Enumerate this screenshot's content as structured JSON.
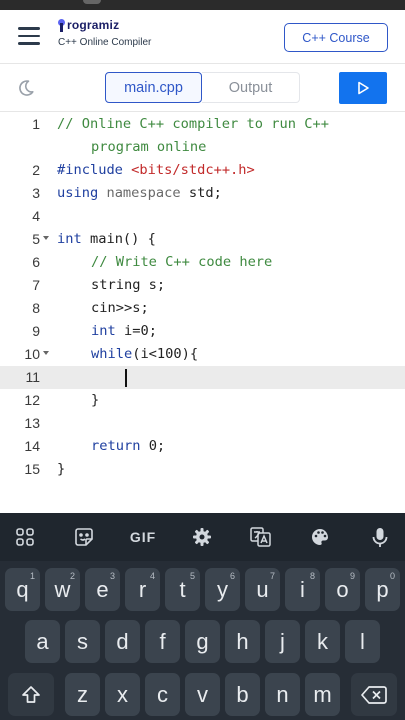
{
  "header": {
    "brand": "rogramiz",
    "subtitle": "C++ Online Compiler",
    "course_button": "C++ Course"
  },
  "toolbar": {
    "tab_main": "main.cpp",
    "tab_output": "Output"
  },
  "editor": {
    "lines": [
      {
        "n": "1",
        "text": "// Online C++ compiler to run C++"
      },
      {
        "n": "",
        "text": "program online"
      },
      {
        "n": "2",
        "pre": "#include ",
        "str": "<bits/stdc++.h>"
      },
      {
        "n": "3",
        "kw": "using",
        "mid": " ",
        "kw2": "namespace",
        "rest": " std;"
      },
      {
        "n": "4"
      },
      {
        "n": "5",
        "kw": "int",
        "rest": " main() {"
      },
      {
        "n": "6",
        "text": "// Write C++ code here"
      },
      {
        "n": "7",
        "rest": "string s;"
      },
      {
        "n": "8",
        "rest": "cin>>s;"
      },
      {
        "n": "9",
        "kw": "int",
        "rest": " i=0;"
      },
      {
        "n": "10",
        "kw": "while",
        "rest": "(i<100){"
      },
      {
        "n": "11"
      },
      {
        "n": "12",
        "rest": "}"
      },
      {
        "n": "13"
      },
      {
        "n": "14",
        "kw": "return",
        "rest": " 0;"
      },
      {
        "n": "15",
        "rest": "}"
      }
    ]
  },
  "keyboard": {
    "gif_label": "GIF",
    "row1": [
      {
        "k": "q",
        "s": "1"
      },
      {
        "k": "w",
        "s": "2"
      },
      {
        "k": "e",
        "s": "3"
      },
      {
        "k": "r",
        "s": "4"
      },
      {
        "k": "t",
        "s": "5"
      },
      {
        "k": "y",
        "s": "6"
      },
      {
        "k": "u",
        "s": "7"
      },
      {
        "k": "i",
        "s": "8"
      },
      {
        "k": "o",
        "s": "9"
      },
      {
        "k": "p",
        "s": "0"
      }
    ],
    "row2": [
      "a",
      "s",
      "d",
      "f",
      "g",
      "h",
      "j",
      "k",
      "l"
    ],
    "row3": [
      "z",
      "x",
      "c",
      "v",
      "b",
      "n",
      "m"
    ]
  },
  "colors": {
    "accent": "#2f57c8",
    "run_button": "#1273ee",
    "comment": "#3f8a40",
    "keyword": "#2040a0",
    "string": "#c22a2a",
    "keyboard_bg": "#262d36"
  },
  "icons": [
    "menu-icon",
    "moon-icon",
    "play-icon",
    "apps-icon",
    "sticker-icon",
    "gear-icon",
    "translate-icon",
    "palette-icon",
    "mic-icon",
    "shift-icon",
    "backspace-icon"
  ]
}
